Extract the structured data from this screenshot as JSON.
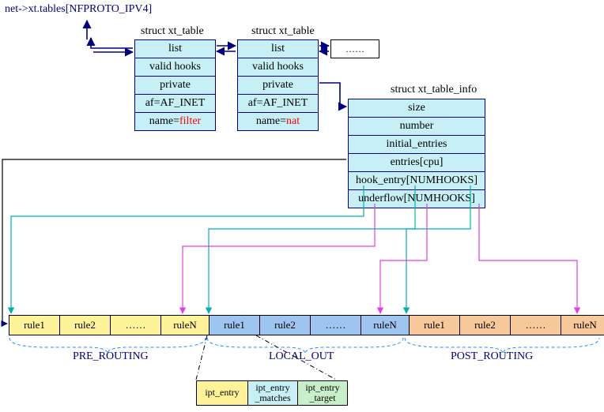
{
  "top_link": "net->xt.tables[NFPROTO_IPV4]",
  "xt_table_label": "struct xt_table",
  "xt_table_info_label": "struct xt_table_info",
  "ellipsis": "……",
  "table1": {
    "list": "list",
    "valid_hooks": "valid hooks",
    "private": "private",
    "af": "af=AF_INET",
    "name_pre": "name=",
    "name_val": "filter"
  },
  "table2": {
    "list": "list",
    "valid_hooks": "valid hooks",
    "private": "private",
    "af": "af=AF_INET",
    "name_pre": "name=",
    "name_val": "nat"
  },
  "info": {
    "size": "size",
    "number": "number",
    "initial_entries": "initial_entries",
    "entries": "entries[cpu]",
    "hook_entry": "hook_entry[NUMHOOKS]",
    "underflow": "underflow[NUMHOOKS]"
  },
  "rules": {
    "r1": "rule1",
    "r2": "rule2",
    "dots": "……",
    "rN": "ruleN"
  },
  "sections": {
    "pre": "PRE_ROUTING",
    "local": "LOCAL_OUT",
    "post": "POST_ROUTING"
  },
  "ipt": {
    "entry": "ipt_entry",
    "matches_l1": "ipt_entry",
    "matches_l2": "_matches",
    "target_l1": "ipt_entry",
    "target_l2": "_target"
  }
}
